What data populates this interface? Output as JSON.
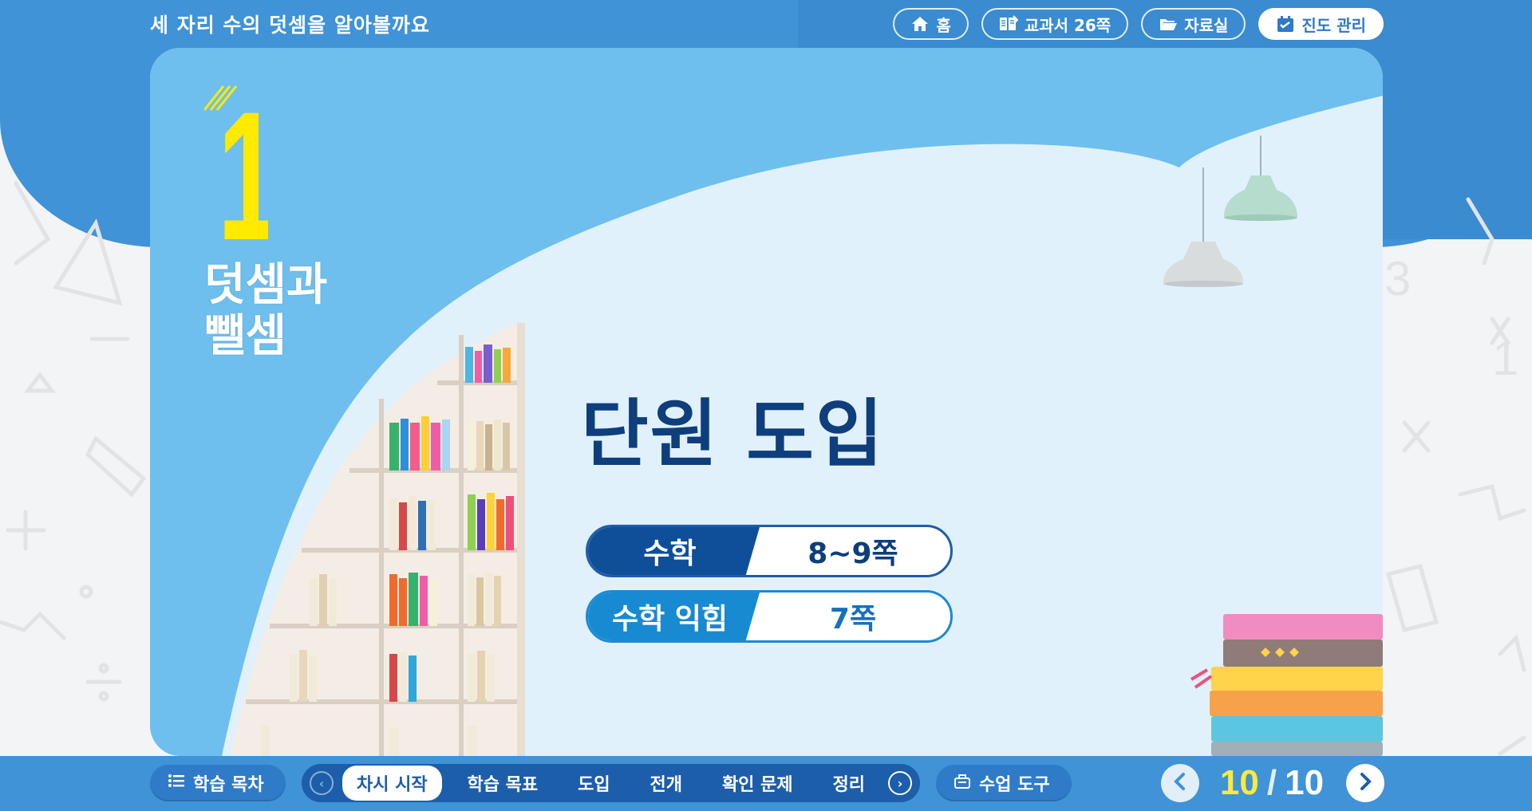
{
  "header": {
    "title": "세 자리 수의 덧셈을 알아볼까요"
  },
  "top_nav": [
    {
      "label": "홈",
      "icon": "home-icon"
    },
    {
      "label": "교과서 26쪽",
      "icon": "textbook-icon"
    },
    {
      "label": "자료실",
      "icon": "folder-icon"
    },
    {
      "label": "진도 관리",
      "icon": "calendar-icon",
      "active": true
    }
  ],
  "unit": {
    "number": "1",
    "title": "덧셈과\n뺄셈"
  },
  "section": {
    "heading": "단원 도입"
  },
  "pages": [
    {
      "book": "수학",
      "page": "8~9쪽"
    },
    {
      "book": "수학 익힘",
      "page": "7쪽"
    }
  ],
  "bottom": {
    "toc_label": "학습 목차",
    "tools_label": "수업 도구",
    "steps": [
      {
        "label": "차시 시작",
        "active": true
      },
      {
        "label": "학습 목표"
      },
      {
        "label": "도입"
      },
      {
        "label": "전개"
      },
      {
        "label": "확인 문제"
      },
      {
        "label": "정리"
      }
    ],
    "pager": {
      "current": "10",
      "separator": "/",
      "total": "10"
    }
  },
  "colors": {
    "primary_blue": "#3f93d6",
    "dark_navy": "#0e3e7c",
    "accent_yellow": "#ffe93a"
  }
}
